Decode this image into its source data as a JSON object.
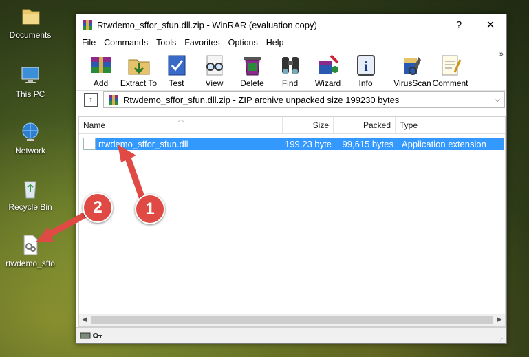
{
  "desktop": {
    "icons": [
      {
        "label": "Documents",
        "icon": "folder-icon"
      },
      {
        "label": "This PC",
        "icon": "computer-icon"
      },
      {
        "label": "Network",
        "icon": "network-icon"
      },
      {
        "label": "Recycle Bin",
        "icon": "recycle-bin-icon"
      },
      {
        "label": "rtwdemo_sffo",
        "icon": "dll-file-icon"
      }
    ]
  },
  "window": {
    "title": "Rtwdemo_sffor_sfun.dll.zip - WinRAR (evaluation copy)",
    "help_btn": "?",
    "close_btn": "✕"
  },
  "menu": [
    "File",
    "Commands",
    "Tools",
    "Favorites",
    "Options",
    "Help"
  ],
  "toolbar": [
    {
      "label": "Add",
      "icon": "add-books-icon"
    },
    {
      "label": "Extract To",
      "icon": "extract-folder-icon"
    },
    {
      "label": "Test",
      "icon": "test-check-icon"
    },
    {
      "label": "View",
      "icon": "view-glasses-icon"
    },
    {
      "label": "Delete",
      "icon": "delete-icon"
    },
    {
      "label": "Find",
      "icon": "binoculars-icon"
    },
    {
      "label": "Wizard",
      "icon": "wizard-icon"
    },
    {
      "label": "Info",
      "icon": "info-icon"
    },
    {
      "label": "VirusScan",
      "icon": "virusscan-icon"
    },
    {
      "label": "Comment",
      "icon": "comment-icon"
    }
  ],
  "toolbar_more": "»",
  "path": {
    "up_icon": "↑",
    "text": "Rtwdemo_sffor_sfun.dll.zip - ZIP archive unpacked size 199230 bytes",
    "dropdown": "⌵"
  },
  "columns": {
    "name": "Name",
    "size": "Size",
    "packed": "Packed",
    "type": "Type"
  },
  "files": [
    {
      "name": "rtwdemo_sffor_sfun.dll",
      "size": "199,23 byte",
      "packed": "99,615 bytes",
      "type": "Application extension"
    }
  ],
  "annotations": {
    "badge1": "1",
    "badge2": "2"
  },
  "colors": {
    "selection": "#3399ff",
    "badge": "#e04a45"
  }
}
